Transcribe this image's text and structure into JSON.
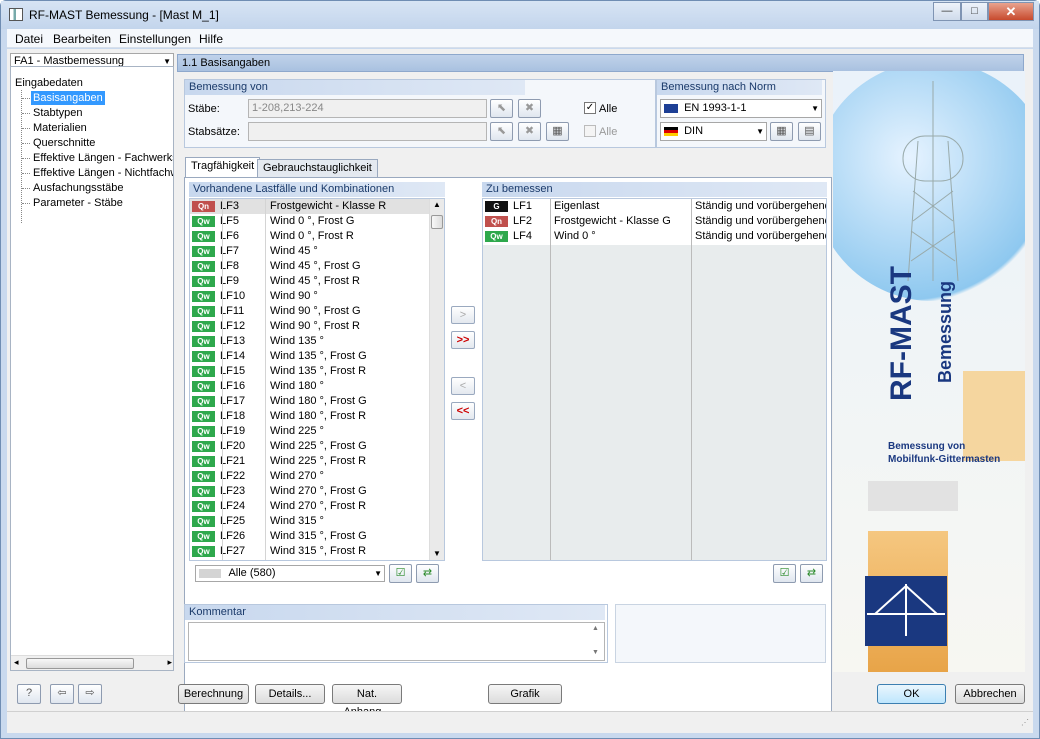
{
  "window": {
    "title": "RF-MAST Bemessung - [Mast M_1]",
    "min_glyph": "—",
    "max_glyph": "□",
    "close_glyph": "✕"
  },
  "menu": [
    "Datei",
    "Bearbeiten",
    "Einstellungen",
    "Hilfe"
  ],
  "case_select": {
    "value": "FA1 - Mastbemessung"
  },
  "tree": {
    "root": "Eingabedaten",
    "items": [
      "Basisangaben",
      "Stabtypen",
      "Materialien",
      "Querschnitte",
      "Effektive Längen - Fachwerkstä",
      "Effektive Längen - Nichtfachwe",
      "Ausfachungsstäbe",
      "Parameter - Stäbe"
    ],
    "selected": "Basisangaben"
  },
  "header": {
    "title": "1.1 Basisangaben"
  },
  "bemessung_von": {
    "title": "Bemessung von",
    "staebe_label": "Stäbe:",
    "staebe_value": "1-208,213-224",
    "stabsaetze_label": "Stabsätze:",
    "stabsaetze_value": "",
    "alle_label": "Alle",
    "alle_checked_mark": "✓"
  },
  "norm": {
    "title": "Bemessung nach Norm",
    "norm_value": "EN 1993-1-1",
    "annex_value": "DIN"
  },
  "tabs": [
    "Tragfähigkeit",
    "Gebrauchstauglichkeit"
  ],
  "active_tab": "Tragfähigkeit",
  "available": {
    "title": "Vorhandene Lastfälle und Kombinationen",
    "filter": "Alle (580)",
    "rows": [
      {
        "badge": "Qn",
        "color": "#c0504d",
        "id": "LF3",
        "desc": "Frostgewicht - Klasse R"
      },
      {
        "badge": "Qw",
        "color": "#2ea84c",
        "id": "LF5",
        "desc": "Wind 0 °, Frost G"
      },
      {
        "badge": "Qw",
        "color": "#2ea84c",
        "id": "LF6",
        "desc": "Wind 0 °, Frost R"
      },
      {
        "badge": "Qw",
        "color": "#2ea84c",
        "id": "LF7",
        "desc": "Wind 45 °"
      },
      {
        "badge": "Qw",
        "color": "#2ea84c",
        "id": "LF8",
        "desc": "Wind 45 °, Frost G"
      },
      {
        "badge": "Qw",
        "color": "#2ea84c",
        "id": "LF9",
        "desc": "Wind 45 °, Frost R"
      },
      {
        "badge": "Qw",
        "color": "#2ea84c",
        "id": "LF10",
        "desc": "Wind 90 °"
      },
      {
        "badge": "Qw",
        "color": "#2ea84c",
        "id": "LF11",
        "desc": "Wind 90 °, Frost G"
      },
      {
        "badge": "Qw",
        "color": "#2ea84c",
        "id": "LF12",
        "desc": "Wind 90 °, Frost R"
      },
      {
        "badge": "Qw",
        "color": "#2ea84c",
        "id": "LF13",
        "desc": "Wind 135 °"
      },
      {
        "badge": "Qw",
        "color": "#2ea84c",
        "id": "LF14",
        "desc": "Wind 135 °, Frost G"
      },
      {
        "badge": "Qw",
        "color": "#2ea84c",
        "id": "LF15",
        "desc": "Wind 135 °, Frost R"
      },
      {
        "badge": "Qw",
        "color": "#2ea84c",
        "id": "LF16",
        "desc": "Wind 180 °"
      },
      {
        "badge": "Qw",
        "color": "#2ea84c",
        "id": "LF17",
        "desc": "Wind 180 °, Frost G"
      },
      {
        "badge": "Qw",
        "color": "#2ea84c",
        "id": "LF18",
        "desc": "Wind 180 °, Frost R"
      },
      {
        "badge": "Qw",
        "color": "#2ea84c",
        "id": "LF19",
        "desc": "Wind 225 °"
      },
      {
        "badge": "Qw",
        "color": "#2ea84c",
        "id": "LF20",
        "desc": "Wind 225 °, Frost G"
      },
      {
        "badge": "Qw",
        "color": "#2ea84c",
        "id": "LF21",
        "desc": "Wind 225 °, Frost R"
      },
      {
        "badge": "Qw",
        "color": "#2ea84c",
        "id": "LF22",
        "desc": "Wind 270 °"
      },
      {
        "badge": "Qw",
        "color": "#2ea84c",
        "id": "LF23",
        "desc": "Wind 270 °, Frost G"
      },
      {
        "badge": "Qw",
        "color": "#2ea84c",
        "id": "LF24",
        "desc": "Wind 270 °, Frost R"
      },
      {
        "badge": "Qw",
        "color": "#2ea84c",
        "id": "LF25",
        "desc": "Wind 315 °"
      },
      {
        "badge": "Qw",
        "color": "#2ea84c",
        "id": "LF26",
        "desc": "Wind 315 °, Frost G"
      },
      {
        "badge": "Qw",
        "color": "#2ea84c",
        "id": "LF27",
        "desc": "Wind 315 °, Frost R"
      }
    ]
  },
  "to_design": {
    "title": "Zu bemessen",
    "rows": [
      {
        "badge": "G",
        "color": "#111111",
        "id": "LF1",
        "desc": "Eigenlast",
        "type": "Ständig und vorübergehend"
      },
      {
        "badge": "Qn",
        "color": "#c0504d",
        "id": "LF2",
        "desc": "Frostgewicht - Klasse G",
        "type": "Ständig und vorübergehend"
      },
      {
        "badge": "Qw",
        "color": "#2ea84c",
        "id": "LF4",
        "desc": "Wind 0 °",
        "type": "Ständig und vorübergehend"
      }
    ]
  },
  "move_buttons": {
    "add": ">",
    "add_all": ">>",
    "remove": "<",
    "remove_all": "<<"
  },
  "comment": {
    "title": "Kommentar",
    "value": ""
  },
  "side_banner": {
    "title": "RF-MAST",
    "subtitle": "Bemessung",
    "caption_line1": "Bemessung von",
    "caption_line2": "Mobilfunk-Gittermasten"
  },
  "bottom_buttons": {
    "berechnung": "Berechnung",
    "details": "Details...",
    "nat_anhang": "Nat. Anhang...",
    "grafik": "Grafik",
    "ok": "OK",
    "abbrechen": "Abbrechen"
  },
  "colors": {
    "accent": "#3399ff",
    "header_blue": "#a9c1e0",
    "group_title": "#1a3a6a"
  }
}
